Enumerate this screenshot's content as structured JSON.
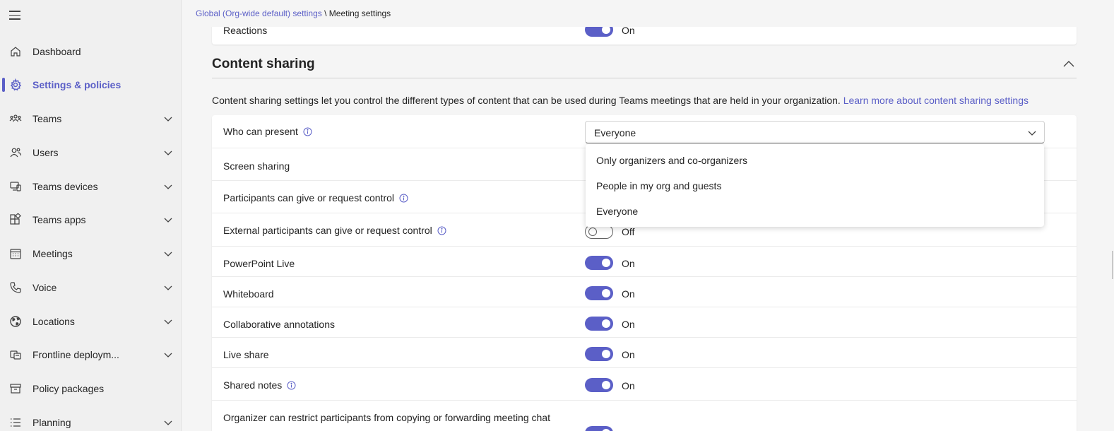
{
  "breadcrumb": {
    "parent": "Global (Org-wide default) settings",
    "separator": "\\",
    "current": "Meeting settings"
  },
  "sidebar": {
    "items": [
      {
        "label": "Dashboard",
        "icon": "home-icon"
      },
      {
        "label": "Settings & policies",
        "icon": "gear-icon",
        "active": true
      },
      {
        "label": "Teams",
        "icon": "teams-icon",
        "expandable": true
      },
      {
        "label": "Users",
        "icon": "users-icon",
        "expandable": true
      },
      {
        "label": "Teams devices",
        "icon": "devices-icon",
        "expandable": true
      },
      {
        "label": "Teams apps",
        "icon": "apps-icon",
        "expandable": true
      },
      {
        "label": "Meetings",
        "icon": "calendar-icon",
        "expandable": true
      },
      {
        "label": "Voice",
        "icon": "phone-icon",
        "expandable": true
      },
      {
        "label": "Locations",
        "icon": "globe-icon",
        "expandable": true
      },
      {
        "label": "Frontline deploym...",
        "icon": "frontline-icon",
        "expandable": true
      },
      {
        "label": "Policy packages",
        "icon": "package-icon"
      },
      {
        "label": "Planning",
        "icon": "list-icon",
        "expandable": true
      }
    ]
  },
  "previous_row": {
    "label": "Reactions",
    "state": "On"
  },
  "section": {
    "title": "Content sharing",
    "description": "Content sharing settings let you control the different types of content that can be used during Teams meetings that are held in your organization.",
    "learn_more": "Learn more about content sharing settings"
  },
  "settings": {
    "who_can_present": {
      "label": "Who can present",
      "value": "Everyone"
    },
    "screen_sharing": {
      "label": "Screen sharing"
    },
    "participants_control": {
      "label": "Participants can give or request control"
    },
    "external_control": {
      "label": "External participants can give or request control",
      "state": "Off"
    },
    "powerpoint_live": {
      "label": "PowerPoint Live",
      "state": "On"
    },
    "whiteboard": {
      "label": "Whiteboard",
      "state": "On"
    },
    "collab_annotations": {
      "label": "Collaborative annotations",
      "state": "On"
    },
    "live_share": {
      "label": "Live share",
      "state": "On"
    },
    "shared_notes": {
      "label": "Shared notes",
      "state": "On"
    },
    "organizer_restrict": {
      "label": "Organizer can restrict participants from copying or forwarding meeting chat"
    }
  },
  "dropdown": {
    "options": [
      "Only organizers and co-organizers",
      "People in my org and guests",
      "Everyone"
    ]
  },
  "colors": {
    "accent": "#5b5fc7",
    "text": "#242424",
    "background": "#f5f5f5"
  }
}
